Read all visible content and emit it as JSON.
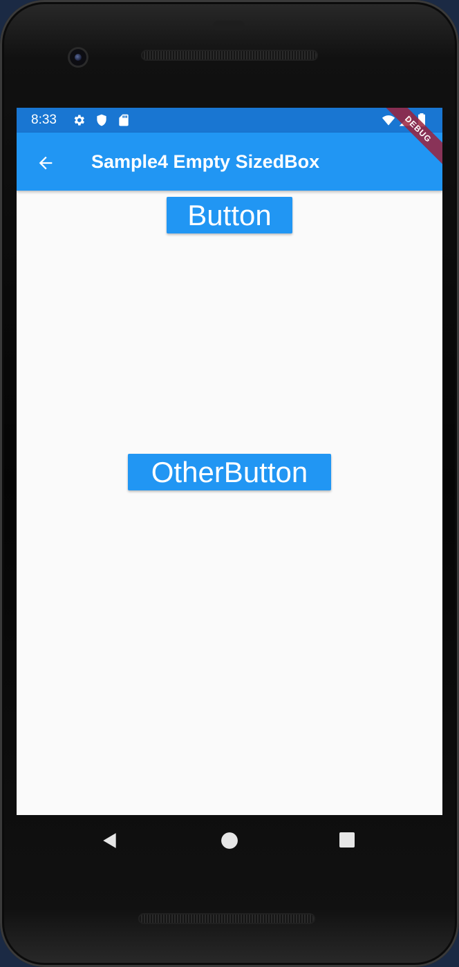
{
  "status_bar": {
    "time": "8:33",
    "icons": [
      "settings-icon",
      "shield-icon",
      "sd-card-icon",
      "wifi-icon",
      "cell-signal-icon",
      "battery-icon"
    ]
  },
  "app_bar": {
    "title": "Sample4 Empty SizedBox",
    "back_icon": "arrow-back-icon",
    "color": "#2196F3"
  },
  "debug_banner": "DEBUG",
  "buttons": {
    "first": "Button",
    "second": "OtherButton"
  },
  "nav_bar": {
    "icons": [
      "nav-back-icon",
      "nav-home-icon",
      "nav-recents-icon"
    ]
  },
  "colors": {
    "status_bar": "#1976D2",
    "button": "#2196F3",
    "background": "#FAFAFA"
  }
}
